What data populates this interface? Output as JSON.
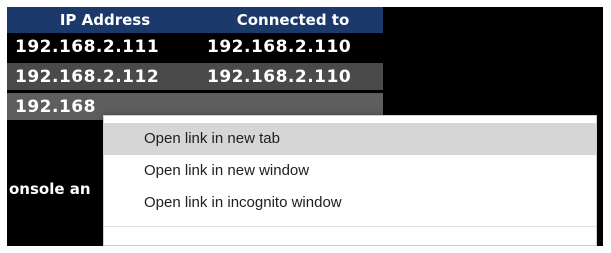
{
  "table": {
    "headers": {
      "ip": "IP Address",
      "connected": "Connected to"
    },
    "rows": [
      {
        "ip": "192.168.2.111",
        "connected": "192.168.2.110"
      },
      {
        "ip": "192.168.2.112",
        "connected": "192.168.2.110"
      },
      {
        "ip": "192.168",
        "connected": ""
      }
    ]
  },
  "background_text": "onsole an",
  "context_menu": {
    "items": [
      {
        "label": "Open link in new tab",
        "highlighted": true
      },
      {
        "label": "Open link in new window",
        "highlighted": false
      },
      {
        "label": "Open link in incognito window",
        "highlighted": false
      }
    ]
  },
  "colors": {
    "header_bg": "#1b3a6b",
    "row_alt_bg": "#4a4a4a",
    "menu_highlight": "#d6d6d6"
  }
}
